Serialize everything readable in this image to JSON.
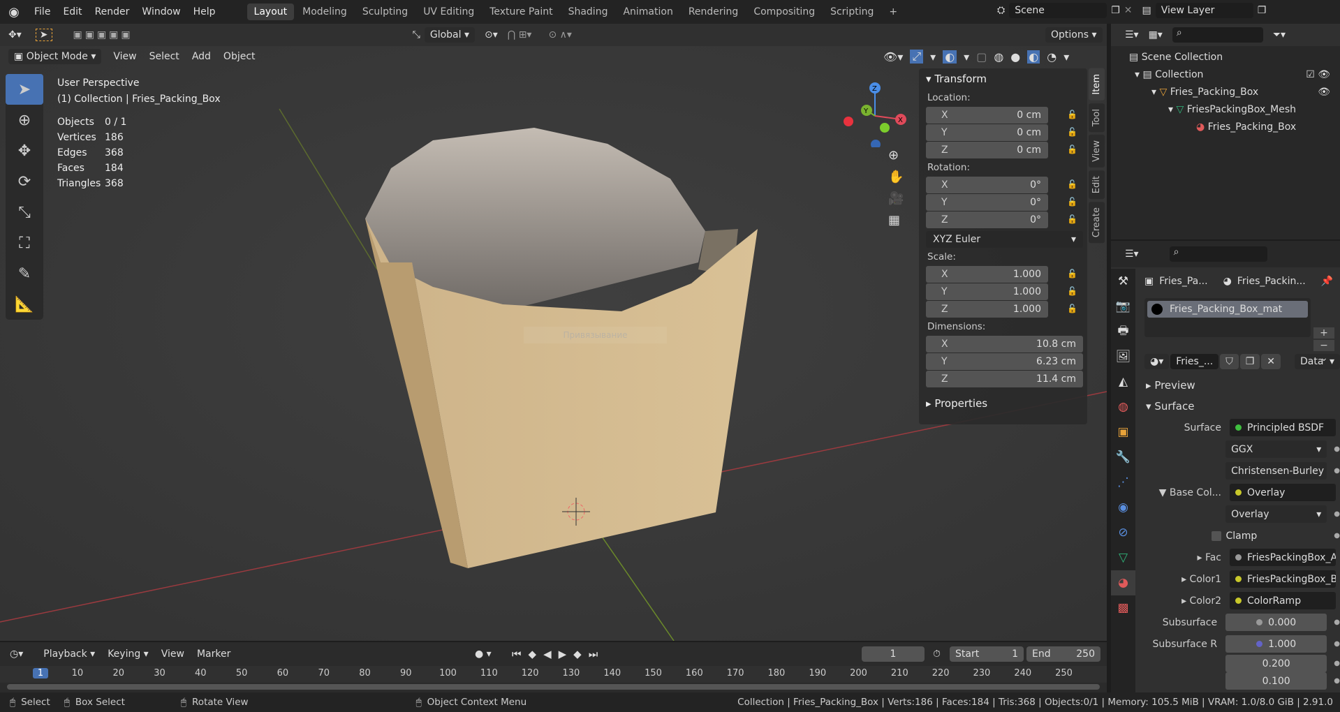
{
  "menu": [
    "File",
    "Edit",
    "Render",
    "Window",
    "Help"
  ],
  "workspaces": [
    "Layout",
    "Modeling",
    "Sculpting",
    "UV Editing",
    "Texture Paint",
    "Shading",
    "Animation",
    "Rendering",
    "Compositing",
    "Scripting"
  ],
  "scene": "Scene",
  "view_layer": "View Layer",
  "toolheader": {
    "orientation": "Global",
    "options": "Options"
  },
  "viewheader": {
    "mode": "Object Mode",
    "menus": [
      "View",
      "Select",
      "Add",
      "Object"
    ]
  },
  "overlay": {
    "perspective": "User Perspective",
    "collection": "(1) Collection | Fries_Packing_Box",
    "stats": [
      [
        "Objects",
        "0 / 1"
      ],
      [
        "Vertices",
        "186"
      ],
      [
        "Edges",
        "368"
      ],
      [
        "Faces",
        "184"
      ],
      [
        "Triangles",
        "368"
      ]
    ],
    "watermark": "Привязывание"
  },
  "gizmo": {
    "x": "X",
    "y": "Y",
    "z": "Z"
  },
  "npanel": {
    "transform": "Transform",
    "location": "Location:",
    "rotation": "Rotation:",
    "scale": "Scale:",
    "dimensions": "Dimensions:",
    "properties": "Properties",
    "rotation_mode": "XYZ Euler",
    "loc": [
      [
        "X",
        "0 cm"
      ],
      [
        "Y",
        "0 cm"
      ],
      [
        "Z",
        "0 cm"
      ]
    ],
    "rot": [
      [
        "X",
        "0°"
      ],
      [
        "Y",
        "0°"
      ],
      [
        "Z",
        "0°"
      ]
    ],
    "scl": [
      [
        "X",
        "1.000"
      ],
      [
        "Y",
        "1.000"
      ],
      [
        "Z",
        "1.000"
      ]
    ],
    "dim": [
      [
        "X",
        "10.8 cm"
      ],
      [
        "Y",
        "6.23 cm"
      ],
      [
        "Z",
        "11.4 cm"
      ]
    ],
    "tabs": [
      "Item",
      "Tool",
      "View",
      "Edit",
      "Create"
    ]
  },
  "timeline": {
    "menus": [
      "Playback",
      "Keying",
      "View",
      "Marker"
    ],
    "current": "1",
    "start_label": "Start",
    "start": "1",
    "end_label": "End",
    "end": "250",
    "ticks": [
      "1",
      "10",
      "20",
      "30",
      "40",
      "50",
      "60",
      "70",
      "80",
      "90",
      "100",
      "110",
      "120",
      "130",
      "140",
      "150",
      "160",
      "170",
      "180",
      "190",
      "200",
      "210",
      "220",
      "230",
      "240",
      "250"
    ]
  },
  "status": {
    "select": "Select",
    "box_select": "Box Select",
    "rotate": "Rotate View",
    "context": "Object Context Menu",
    "info": "Collection | Fries_Packing_Box | Verts:186 | Faces:184 | Tris:368 | Objects:0/1 | Memory: 105.5 MiB | VRAM: 1.0/8.0 GiB | 2.91.0"
  },
  "outliner": {
    "root": "Scene Collection",
    "items": [
      "Collection",
      "Fries_Packing_Box",
      "FriesPackingBox_Mesh",
      "Fries_Packing_Box"
    ]
  },
  "props": {
    "obj": "Fries_Pa...",
    "mat": "Fries_Packin...",
    "slot": "Fries_Packing_Box_mat",
    "mat_name": "Fries_...",
    "link": "Data",
    "preview": "Preview",
    "surface_hdr": "Surface",
    "rows": [
      {
        "label": "Surface",
        "value": "Principled BSDF",
        "dot": "#3fbf3f"
      },
      {
        "label": "",
        "value": "GGX",
        "dd": true
      },
      {
        "label": "",
        "value": "Christensen-Burley",
        "dd": true
      },
      {
        "label": "▼ Base Col...",
        "value": "Overlay",
        "dot": "#c8c82a"
      },
      {
        "label": "",
        "value": "Overlay",
        "dd": true
      },
      {
        "label": "",
        "value": "Clamp",
        "check": true
      },
      {
        "label": "▸        Fac",
        "value": "FriesPackingBox_A...",
        "dot": "#999"
      },
      {
        "label": "▸     Color1",
        "value": "FriesPackingBox_B...",
        "dot": "#c8c82a"
      },
      {
        "label": "▸     Color2",
        "value": "ColorRamp",
        "dot": "#c8c82a"
      },
      {
        "label": "Subsurface",
        "value": "0.000",
        "dot": "#999",
        "num": true
      },
      {
        "label": "Subsurface R",
        "value": "1.000",
        "dot": "#6363c7",
        "num": true
      },
      {
        "label": "",
        "value": "0.200",
        "num": true
      },
      {
        "label": "",
        "value": "0.100",
        "num": true
      }
    ]
  }
}
